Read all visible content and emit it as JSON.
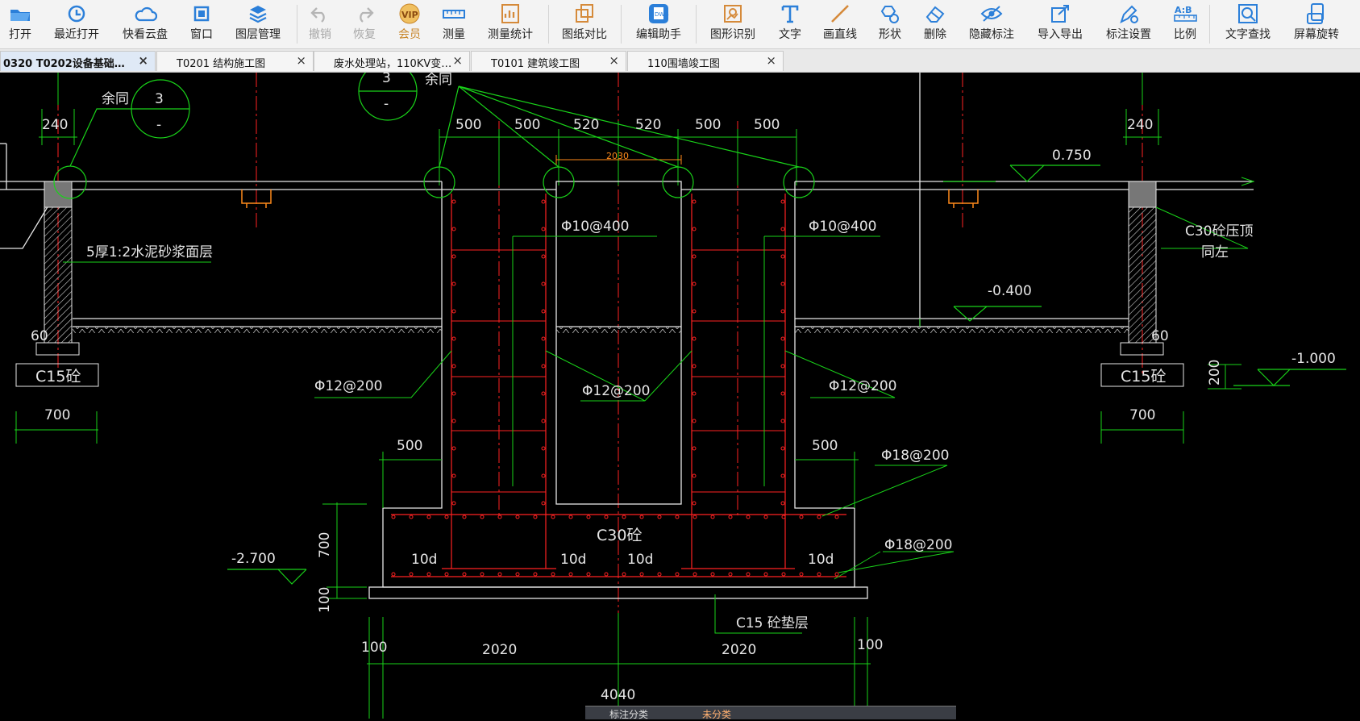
{
  "toolbar": {
    "items": [
      {
        "label": "打开",
        "icon": "folder-open-icon"
      },
      {
        "label": "最近打开",
        "icon": "history-icon"
      },
      {
        "label": "快看云盘",
        "icon": "cloud-icon"
      },
      {
        "label": "窗口",
        "icon": "window-icon"
      },
      {
        "label": "图层管理",
        "icon": "layers-icon"
      },
      {
        "label": "撤销",
        "icon": "undo-icon"
      },
      {
        "label": "恢复",
        "icon": "redo-icon"
      },
      {
        "label": "会员",
        "icon": "vip-icon",
        "badge": "VIP"
      },
      {
        "label": "测量",
        "icon": "ruler-icon"
      },
      {
        "label": "测量统计",
        "icon": "measure-stats-icon"
      },
      {
        "label": "图纸对比",
        "icon": "compare-icon"
      },
      {
        "label": "编辑助手",
        "icon": "edit-assistant-icon"
      },
      {
        "label": "图形识别",
        "icon": "shape-recognition-icon"
      },
      {
        "label": "文字",
        "icon": "text-icon"
      },
      {
        "label": "画直线",
        "icon": "line-icon"
      },
      {
        "label": "形状",
        "icon": "shape-icon"
      },
      {
        "label": "删除",
        "icon": "eraser-icon"
      },
      {
        "label": "隐藏标注",
        "icon": "eye-hidden-icon"
      },
      {
        "label": "导入导出",
        "icon": "import-export-icon"
      },
      {
        "label": "标注设置",
        "icon": "annotation-settings-icon"
      },
      {
        "label": "比例",
        "icon": "scale-icon",
        "badge": "A:B"
      },
      {
        "label": "文字查找",
        "icon": "text-search-icon"
      },
      {
        "label": "屏幕旋转",
        "icon": "rotate-screen-icon"
      }
    ]
  },
  "tabs": [
    {
      "label": "0320 T0202设备基础…",
      "active": true
    },
    {
      "label": "T0201 结构施工图",
      "active": false
    },
    {
      "label": "废水处理站，110KV变…",
      "active": false
    },
    {
      "label": "T0101 建筑竣工图",
      "active": false
    },
    {
      "label": "110围墙竣工图",
      "active": false
    }
  ],
  "drawing": {
    "dims_top": [
      "240",
      "500",
      "500",
      "520",
      "520",
      "500",
      "500",
      "240"
    ],
    "dim_red": "2030",
    "elevations": [
      "0.750",
      "-0.400",
      "-1.000",
      "-2.700"
    ],
    "rebar": [
      "Φ10@400",
      "Φ10@400",
      "Φ12@200",
      "Φ12@200",
      "Φ12@200",
      "Φ18@200",
      "Φ18@200"
    ],
    "anchor": [
      "10d",
      "10d",
      "10d",
      "10d"
    ],
    "concrete": {
      "main": "C30砼",
      "footing_left": "C15砼",
      "footing_right": "C15砼",
      "cushion": "C15 砼垫层",
      "beam": "C30砼压顶",
      "beam_note": "同左"
    },
    "notes": {
      "mortar": "5厚1:2水泥砂浆面层",
      "rest_left": "余同",
      "rest_top": "余同",
      "detail_num": "3",
      "detail_dash": "-"
    },
    "dims_misc": {
      "side_700": "700",
      "side_60": "60",
      "side_500": "500",
      "vert_700": "700",
      "vert_100": "100",
      "vert_200": "200"
    },
    "dims_bottom": {
      "a": "100",
      "b": "2020",
      "c": "2020",
      "d": "100",
      "total": "4040"
    }
  },
  "bottom_panel": {
    "label1": "标注分类",
    "label2": "未分类"
  },
  "colors": {
    "cad_bg": "#000000",
    "green": "#19d219",
    "red": "#ff2222",
    "white": "#e6e6e6",
    "orange": "#ff8a1a",
    "toolbar_bg": "#f3f3f3",
    "icon_blue": "#2b7fd9"
  }
}
